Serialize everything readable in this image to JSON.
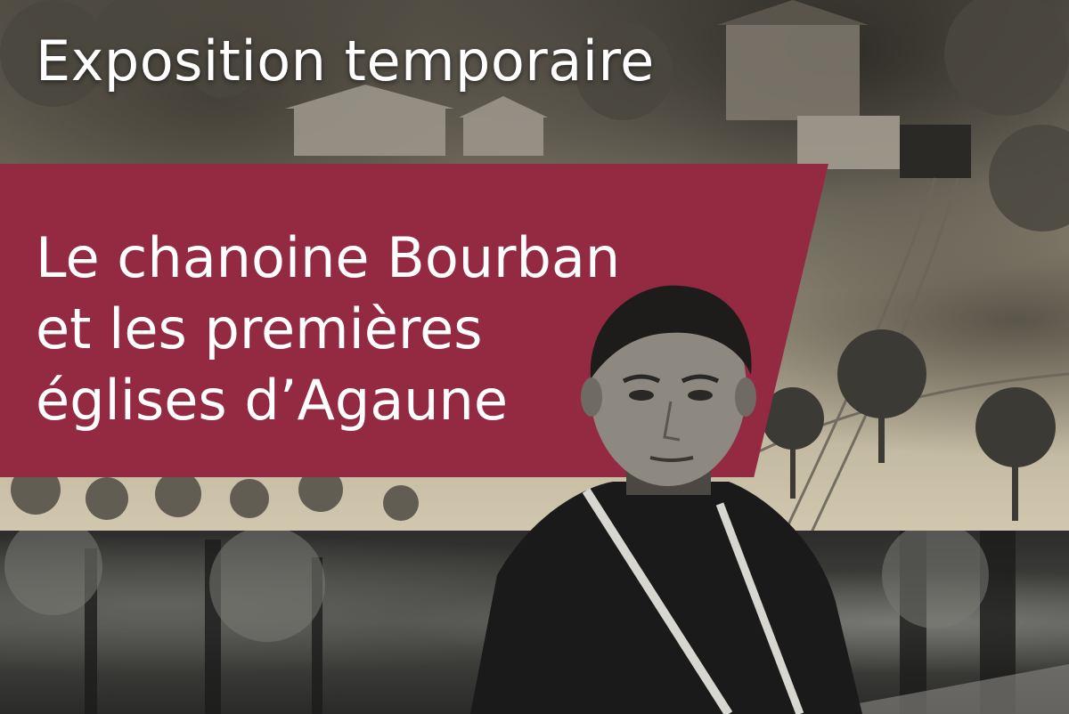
{
  "poster": {
    "kicker": "Exposition temporaire",
    "title_lines": [
      "Le chanoine Bourban",
      "et les premières",
      "églises d’Agaune"
    ]
  },
  "colors": {
    "panel": "#932a41",
    "text": "#ffffff"
  }
}
